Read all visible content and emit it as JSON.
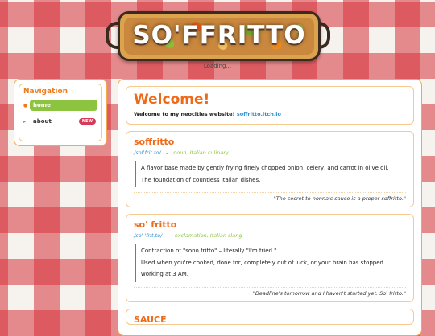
{
  "header": {
    "title": "SO'FFRITTO",
    "loading": "Loading..."
  },
  "sidebar": {
    "title": "Navigation",
    "items": [
      {
        "label": "home",
        "active": true
      },
      {
        "label": "about",
        "badge": "NEW"
      }
    ]
  },
  "welcome": {
    "title": "Welcome!",
    "text": "Welcome to my neocities website!",
    "link": "soffritto.itch.io"
  },
  "entries": [
    {
      "word": "soffritto",
      "pronunciation": "/sof'frit.to/",
      "separator": "–",
      "pos": "noun, Italian culinary",
      "definition": [
        "A flavor base made by gently frying finely chopped onion, celery, and carrot in olive oil.",
        "The foundation of countless Italian dishes."
      ],
      "quote": "\"The secret to nonna's sauce is a proper soffritto.\""
    },
    {
      "word": "so' fritto",
      "pronunciation": "/so' 'frit.to/",
      "separator": "–",
      "pos": "exclamation, Italian slang",
      "definition": [
        "Contraction of \"sono fritto\" – literally \"I'm fried.\"",
        "Used when you're cooked, done for, completely out of luck, or your brain has stopped working at 3 AM."
      ],
      "quote": "\"Deadline's tomorrow and I haven't started yet. So' fritto.\""
    }
  ],
  "next_entry": {
    "word": "SAUCE"
  }
}
